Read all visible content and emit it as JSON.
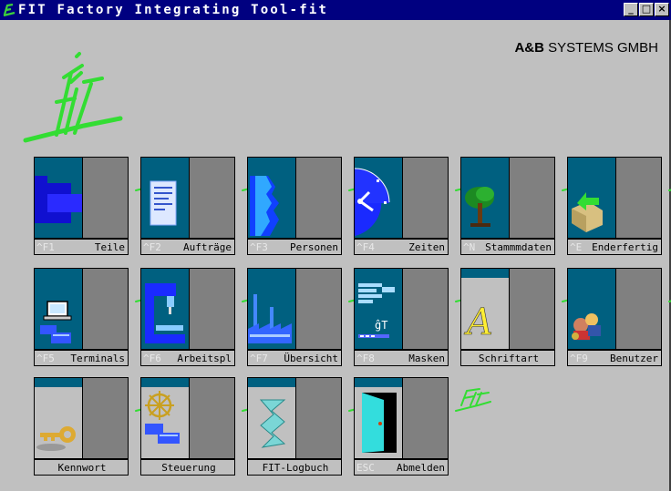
{
  "window": {
    "title": "FIT Factory Integrating Tool-fit",
    "buttons": [
      "_",
      "□",
      "×"
    ]
  },
  "company": {
    "brand": "A&B",
    "rest": " SYSTEMS GMBH"
  },
  "logo_text": "FIT",
  "tiles": [
    {
      "key": "^F1",
      "label": "Teile",
      "icon": "parts-icon"
    },
    {
      "key": "^F2",
      "label": "Aufträge",
      "icon": "document-icon"
    },
    {
      "key": "^F3",
      "label": "Personen",
      "icon": "faces-icon"
    },
    {
      "key": "^F4",
      "label": "Zeiten",
      "icon": "clock-icon"
    },
    {
      "key": "^N",
      "label": "Stammmdaten",
      "icon": "tree-icon"
    },
    {
      "key": "^E",
      "label": "Enderfertig",
      "icon": "box-arrow-icon"
    },
    {
      "key": "^F5",
      "label": "Terminals",
      "icon": "computer-icon"
    },
    {
      "key": "^F6",
      "label": "Arbeitspl",
      "icon": "drill-press-icon"
    },
    {
      "key": "^F7",
      "label": "Übersicht",
      "icon": "factory-icon"
    },
    {
      "key": "^F8",
      "label": "Masken",
      "icon": "screen-mask-icon"
    },
    {
      "key": "",
      "label": "Schriftart",
      "icon": "font-icon"
    },
    {
      "key": "^F9",
      "label": "Benutzer",
      "icon": "users-icon"
    },
    {
      "key": "",
      "label": "Kennwort",
      "icon": "key-icon"
    },
    {
      "key": "",
      "label": "Steuerung",
      "icon": "helm-icon"
    },
    {
      "key": "",
      "label": "FIT-Logbuch",
      "icon": "logbook-icon"
    },
    {
      "key": "ESC",
      "label": "Abmelden",
      "icon": "door-icon"
    }
  ],
  "tile_mark": "FIT"
}
